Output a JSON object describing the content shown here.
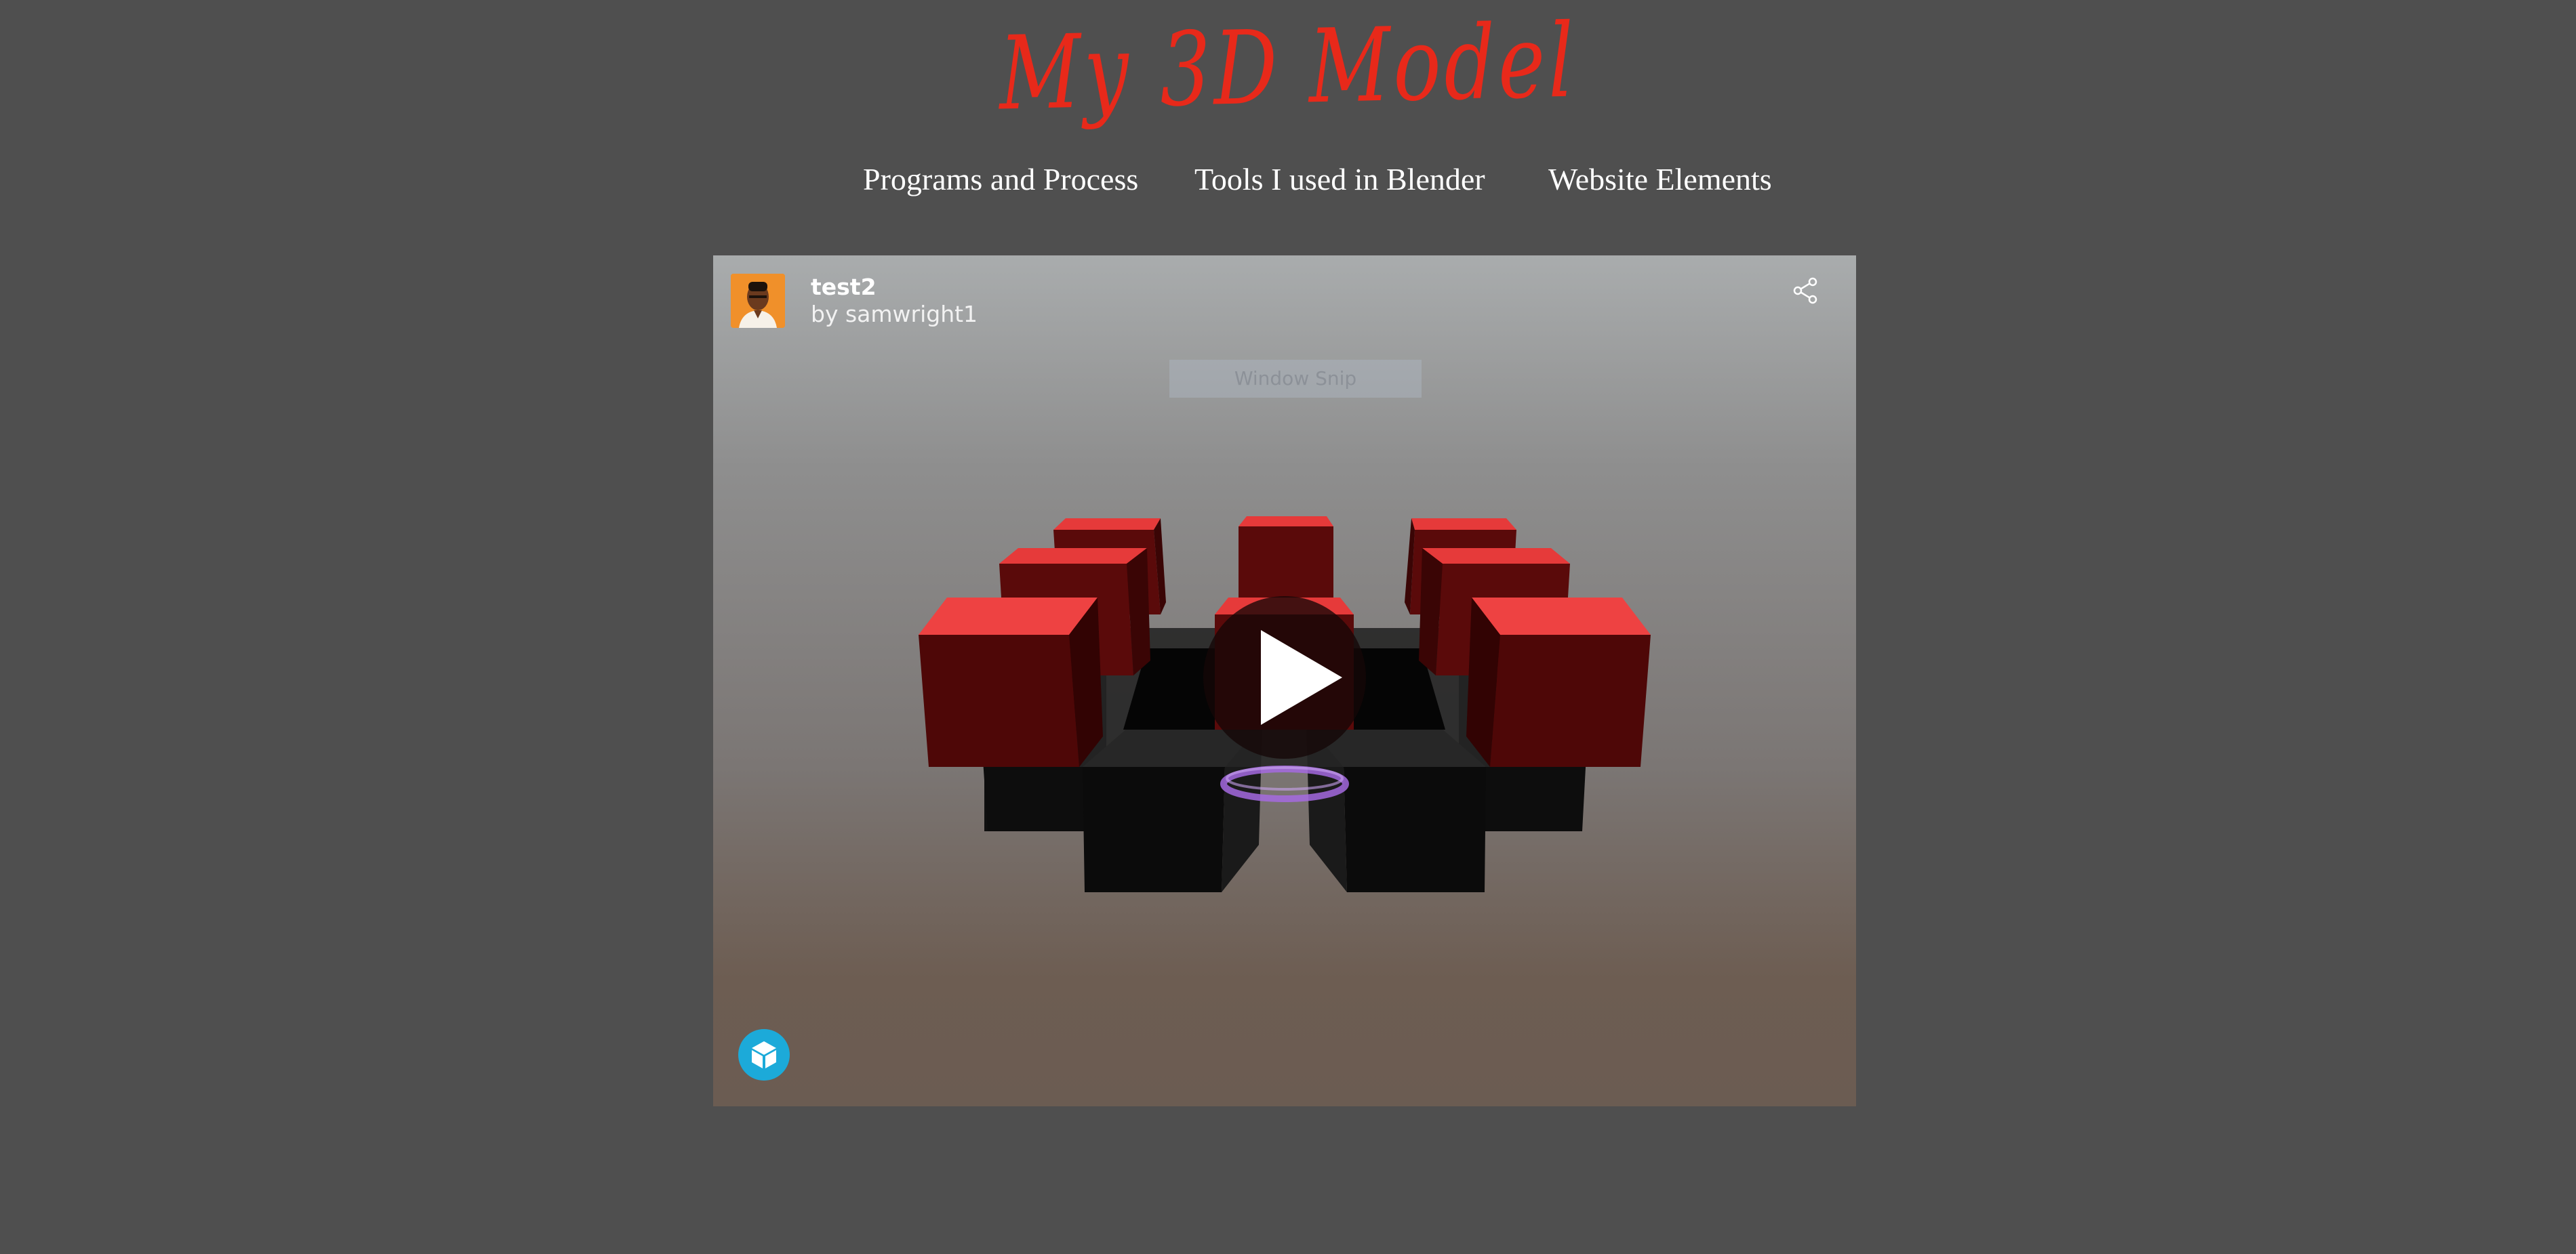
{
  "site": {
    "title": "My 3D Model"
  },
  "nav": {
    "items": [
      {
        "label": "Programs and Process"
      },
      {
        "label": "Tools I used in Blender"
      },
      {
        "label": "Website Elements"
      }
    ]
  },
  "viewer": {
    "model_title": "test2",
    "model_author": "by samwright1",
    "overlay_label": "Window Snip",
    "icons": {
      "share": "share-icon",
      "play": "play-icon",
      "brand": "sketchfab-logo-icon",
      "avatar": "user-avatar"
    },
    "colors": {
      "cube_red": "#e63a3a",
      "cube_black": "#121212",
      "glow": "#a56ae0",
      "play_bg": "#140606",
      "brand": "#1caad9"
    }
  }
}
